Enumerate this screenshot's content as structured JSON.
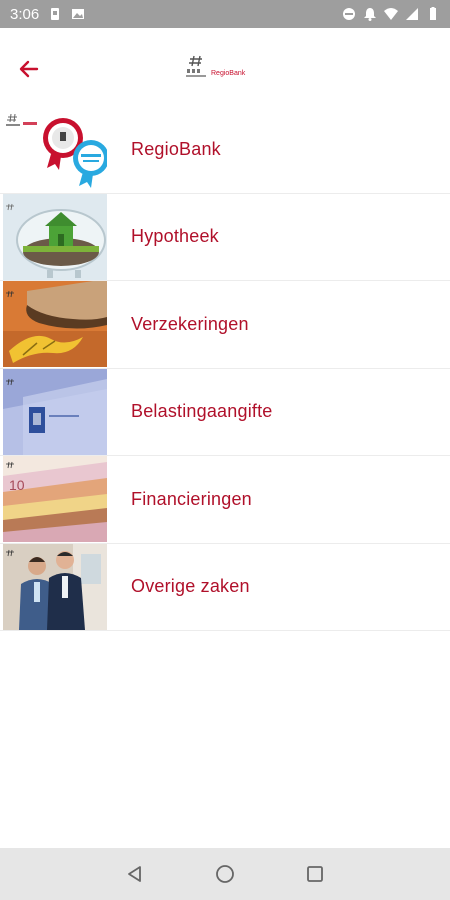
{
  "status_bar": {
    "time": "3:06",
    "icons": [
      "sim-icon",
      "image-icon",
      "dnd-icon",
      "notification-icon",
      "wifi-icon",
      "signal-icon",
      "battery-icon"
    ]
  },
  "app_bar": {
    "back_icon": "arrow-back-icon",
    "logo_text": "RegioBank"
  },
  "menu": {
    "items": [
      {
        "label": "RegioBank",
        "thumb": "regiobank-badges"
      },
      {
        "label": "Hypotheek",
        "thumb": "piggybank-house"
      },
      {
        "label": "Verzekeringen",
        "thumb": "shoe-banana"
      },
      {
        "label": "Belastingaangifte",
        "thumb": "tax-envelope"
      },
      {
        "label": "Financieringen",
        "thumb": "banknotes"
      },
      {
        "label": "Overige zaken",
        "thumb": "two-advisors"
      }
    ]
  },
  "nav_bar": {
    "icons": [
      "back-triangle-icon",
      "home-circle-icon",
      "recents-square-icon"
    ]
  },
  "colors": {
    "accent": "#b0102a",
    "status_bar": "#9e9e9e",
    "nav_bar": "#e6e6e6"
  }
}
